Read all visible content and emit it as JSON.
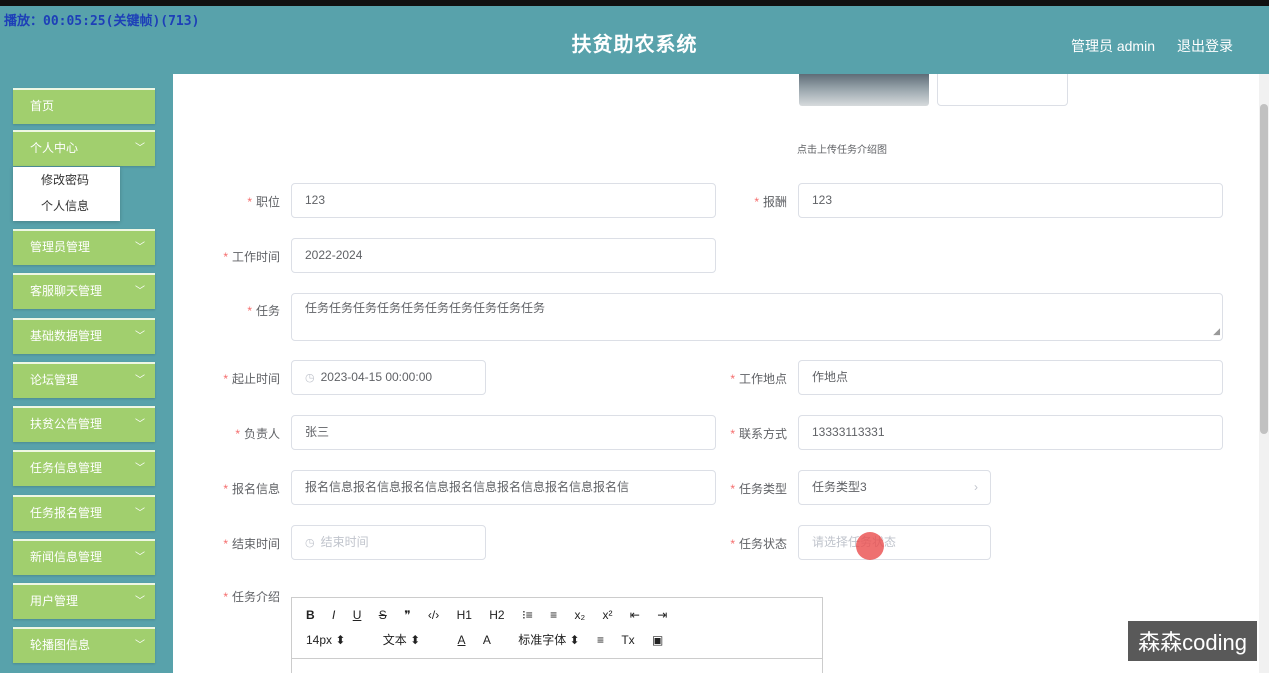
{
  "recording_label": "播放：00:05:25(关键帧)(713)",
  "header": {
    "title": "扶贫助农系统",
    "admin_label": "管理员 admin",
    "logout": "退出登录"
  },
  "sidebar": {
    "items": [
      {
        "label": "首页",
        "chevron": false
      },
      {
        "label": "个人中心",
        "chevron": true
      },
      {
        "label": "管理员管理",
        "chevron": true
      },
      {
        "label": "客服聊天管理",
        "chevron": true
      },
      {
        "label": "基础数据管理",
        "chevron": true
      },
      {
        "label": "论坛管理",
        "chevron": true
      },
      {
        "label": "扶贫公告管理",
        "chevron": true
      },
      {
        "label": "任务信息管理",
        "chevron": true
      },
      {
        "label": "任务报名管理",
        "chevron": true
      },
      {
        "label": "新闻信息管理",
        "chevron": true
      },
      {
        "label": "用户管理",
        "chevron": true
      },
      {
        "label": "轮播图信息",
        "chevron": true
      }
    ],
    "submenu": [
      "修改密码",
      "个人信息"
    ]
  },
  "form": {
    "upload_hint": "点击上传任务介绍图",
    "zhiwei": {
      "label": "职位",
      "value": "123"
    },
    "baochou": {
      "label": "报酬",
      "value": "123"
    },
    "gongzuo_shijian": {
      "label": "工作时间",
      "value": "2022-2024"
    },
    "renwu": {
      "label": "任务",
      "value": "任务任务任务任务任务任务任务任务任务任务"
    },
    "qizhi_shijian": {
      "label": "起止时间",
      "value": "2023-04-15 00:00:00"
    },
    "gongzuo_didian": {
      "label": "工作地点",
      "value": "作地点"
    },
    "fuzeren": {
      "label": "负责人",
      "value": "张三"
    },
    "lianxi_fangshi": {
      "label": "联系方式",
      "value": "13333113331"
    },
    "baoming_xinxi": {
      "label": "报名信息",
      "value": "报名信息报名信息报名信息报名信息报名信息报名信息报名信"
    },
    "renwu_leixing": {
      "label": "任务类型",
      "value": "任务类型3"
    },
    "jieshu_shijian": {
      "label": "结束时间",
      "placeholder": "结束时间"
    },
    "renwu_zhuangtai": {
      "label": "任务状态",
      "placeholder": "请选择任务状态"
    },
    "renwu_jieshao": {
      "label": "任务介绍"
    }
  },
  "editor": {
    "row1": [
      "B",
      "I",
      "U",
      "S",
      "❞",
      "‹/›",
      "H1",
      "H2",
      "⁝≡",
      "≡",
      "x₂",
      "x²",
      "⇤",
      "⇥"
    ],
    "row2": [
      "14px ⬍",
      "文本 ⬍",
      "A",
      "A",
      "标准字体 ⬍",
      "≡",
      "Tx",
      "▣"
    ]
  },
  "watermark": "森森coding"
}
